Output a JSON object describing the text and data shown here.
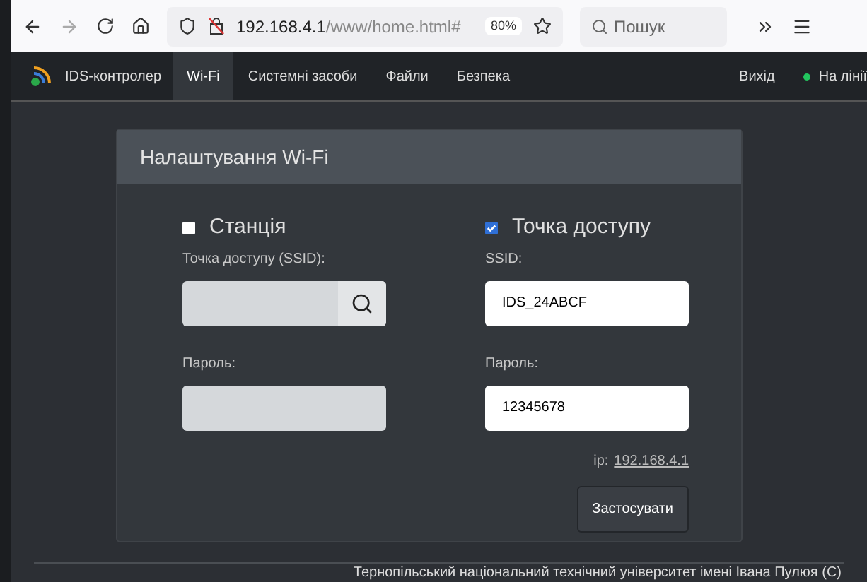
{
  "browser": {
    "url_host": "192.168.4.1",
    "url_path": "/www/home.html#",
    "zoom": "80%",
    "search_placeholder": "Пошук"
  },
  "navbar": {
    "brand": "IDS-контролер",
    "items": [
      {
        "label": "Wi-Fi",
        "selected": true
      },
      {
        "label": "Системні засоби",
        "selected": false
      },
      {
        "label": "Файли",
        "selected": false
      },
      {
        "label": "Безпека",
        "selected": false
      }
    ],
    "logout": "Вихід",
    "status": {
      "label": "На лінії",
      "color": "#22c55e"
    }
  },
  "card": {
    "title": "Налаштування Wi-Fi",
    "station": {
      "label": "Станція",
      "checked": false,
      "ssid_label": "Точка доступу (SSID):",
      "password_label": "Пароль:",
      "disabled": true
    },
    "access_point": {
      "label": "Точка доступу",
      "checked": true,
      "ssid_label": "SSID:",
      "ssid": "IDS_24ABCF",
      "password_label": "Пароль:",
      "password": "12345678",
      "disabled": false
    },
    "ip_label": "ip:",
    "ip": "192.168.4.1",
    "apply": "Застосувати"
  },
  "footer": "Тернопільський національний технічний університет імені Івана Пулюя (С)"
}
